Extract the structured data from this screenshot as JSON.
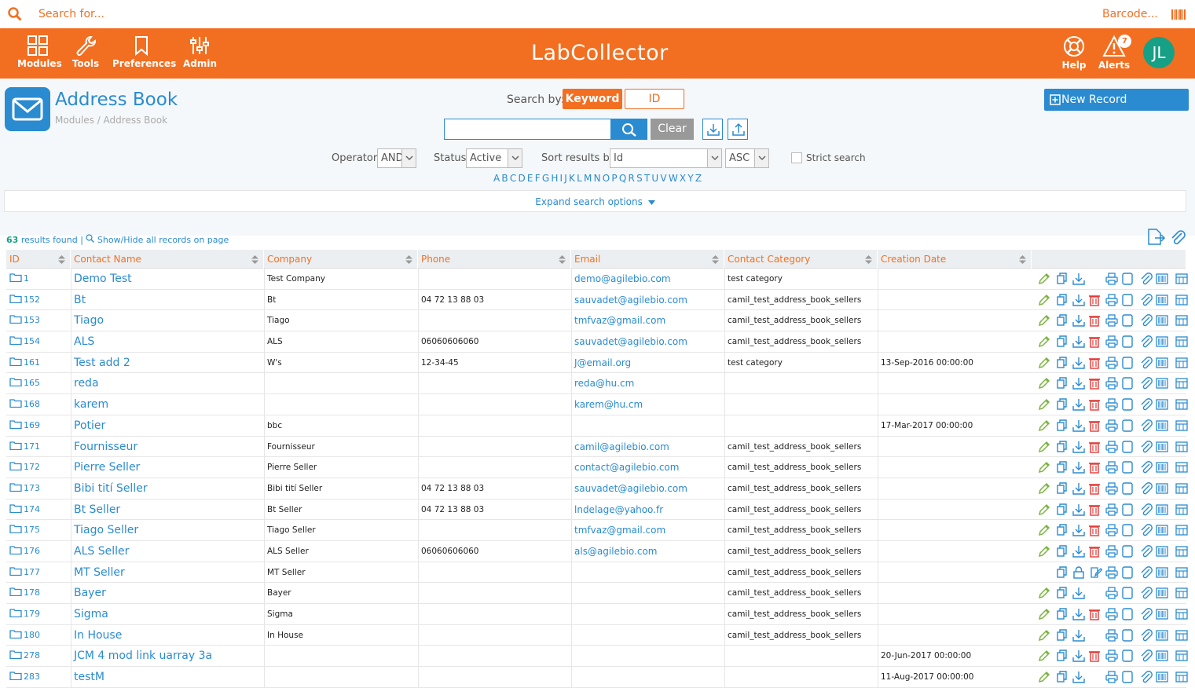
{
  "topbar": {
    "search_placeholder": "Search for...",
    "barcode_label": "Barcode..."
  },
  "nav": {
    "modules": "Modules",
    "tools": "Tools",
    "preferences": "Preferences",
    "admin": "Admin",
    "help": "Help",
    "alerts": "Alerts",
    "alerts_count": "7",
    "avatar": "JL",
    "logo": "LabCollector"
  },
  "page": {
    "title": "Address Book",
    "breadcrumb": "Modules / Address Book",
    "new_record": "New Record"
  },
  "search": {
    "by_label": "Search by:",
    "keyword": "Keyword",
    "id": "ID",
    "clear": "Clear",
    "input_value": ""
  },
  "filters": {
    "operator_label": "Operator:",
    "operator": "AND",
    "status_label": "Status:",
    "status": "Active",
    "sort_label": "Sort results by:",
    "sort": "Id",
    "order": "ASC",
    "strict": "Strict search"
  },
  "alphabet": [
    "A",
    "B",
    "C",
    "D",
    "E",
    "F",
    "G",
    "H",
    "I",
    "J",
    "K",
    "L",
    "M",
    "N",
    "O",
    "P",
    "Q",
    "R",
    "S",
    "T",
    "U",
    "V",
    "W",
    "X",
    "Y",
    "Z"
  ],
  "expand": "Expand search options",
  "results": {
    "count": "63",
    "label": "results found",
    "sep": "|",
    "show_hide": "Show/Hide all records on page"
  },
  "colors": {
    "brand": "#f26f21",
    "accent": "#2a8bd0",
    "green": "#7cb342",
    "red": "#e53935"
  },
  "columns": [
    "ID",
    "Contact Name",
    "Company",
    "Phone",
    "Email",
    "Contact Category",
    "Creation Date"
  ],
  "rows": [
    {
      "id": "1",
      "name": "Demo Test",
      "company": "Test Company",
      "phone": "",
      "email": "demo@agilebio.com",
      "category": "test category",
      "date": "",
      "del": false,
      "lock": false
    },
    {
      "id": "152",
      "name": "Bt",
      "company": "Bt",
      "phone": "04 72 13 88 03",
      "email": "sauvadet@agilebio.com",
      "category": "camil_test_address_book_sellers",
      "date": "",
      "del": true,
      "lock": false
    },
    {
      "id": "153",
      "name": "Tiago",
      "company": "Tiago",
      "phone": "",
      "email": "tmfvaz@gmail.com",
      "category": "camil_test_address_book_sellers",
      "date": "",
      "del": true,
      "lock": false
    },
    {
      "id": "154",
      "name": "ALS",
      "company": "ALS",
      "phone": "06060606060",
      "email": "sauvadet@agilebio.com",
      "category": "camil_test_address_book_sellers",
      "date": "",
      "del": true,
      "lock": false
    },
    {
      "id": "161",
      "name": "Test add 2",
      "company": "W's",
      "phone": "12-34-45",
      "email": "J@email.org",
      "category": "test category",
      "date": "13-Sep-2016 00:00:00",
      "del": true,
      "lock": false
    },
    {
      "id": "165",
      "name": "reda",
      "company": "",
      "phone": "",
      "email": "reda@hu.cm",
      "category": "",
      "date": "",
      "del": true,
      "lock": false
    },
    {
      "id": "168",
      "name": "karem",
      "company": "",
      "phone": "",
      "email": "karem@hu.cm",
      "category": "",
      "date": "",
      "del": true,
      "lock": false
    },
    {
      "id": "169",
      "name": "Potier",
      "company": "bbc",
      "phone": "",
      "email": "",
      "category": "",
      "date": "17-Mar-2017 00:00:00",
      "del": true,
      "lock": false
    },
    {
      "id": "171",
      "name": "Fournisseur",
      "company": "Fournisseur",
      "phone": "",
      "email": "camil@agilebio.com",
      "category": "camil_test_address_book_sellers",
      "date": "",
      "del": true,
      "lock": false
    },
    {
      "id": "172",
      "name": "Pierre Seller",
      "company": "Pierre Seller",
      "phone": "",
      "email": "contact@agilebio.com",
      "category": "camil_test_address_book_sellers",
      "date": "",
      "del": true,
      "lock": false
    },
    {
      "id": "173",
      "name": "Bibi tití Seller",
      "company": "Bibi tití Seller",
      "phone": "04 72 13 88 03",
      "email": "sauvadet@agilebio.com",
      "category": "camil_test_address_book_sellers",
      "date": "",
      "del": true,
      "lock": false
    },
    {
      "id": "174",
      "name": "Bt Seller",
      "company": "Bt Seller",
      "phone": "04 72 13 88 03",
      "email": "lndelage@yahoo.fr",
      "category": "camil_test_address_book_sellers",
      "date": "",
      "del": true,
      "lock": false
    },
    {
      "id": "175",
      "name": "Tiago Seller",
      "company": "Tiago Seller",
      "phone": "",
      "email": "tmfvaz@gmail.com",
      "category": "camil_test_address_book_sellers",
      "date": "",
      "del": true,
      "lock": false
    },
    {
      "id": "176",
      "name": "ALS Seller",
      "company": "ALS Seller",
      "phone": "06060606060",
      "email": "als@agilebio.com",
      "category": "camil_test_address_book_sellers",
      "date": "",
      "del": true,
      "lock": false
    },
    {
      "id": "177",
      "name": "MT Seller",
      "company": "MT Seller",
      "phone": "",
      "email": "",
      "category": "camil_test_address_book_sellers",
      "date": "",
      "del": false,
      "lock": true
    },
    {
      "id": "178",
      "name": "Bayer",
      "company": "Bayer",
      "phone": "",
      "email": "",
      "category": "camil_test_address_book_sellers",
      "date": "",
      "del": false,
      "lock": false
    },
    {
      "id": "179",
      "name": "Sigma",
      "company": "Sigma",
      "phone": "",
      "email": "",
      "category": "camil_test_address_book_sellers",
      "date": "",
      "del": true,
      "lock": false
    },
    {
      "id": "180",
      "name": "In House",
      "company": "In House",
      "phone": "",
      "email": "",
      "category": "camil_test_address_book_sellers",
      "date": "",
      "del": false,
      "lock": false
    },
    {
      "id": "278",
      "name": "JCM 4 mod link uarray 3a",
      "company": "",
      "phone": "",
      "email": "",
      "category": "",
      "date": "20-Jun-2017 00:00:00",
      "del": true,
      "lock": false
    },
    {
      "id": "283",
      "name": "testM",
      "company": "",
      "phone": "",
      "email": "",
      "category": "",
      "date": "11-Aug-2017 00:00:00",
      "del": false,
      "lock": false
    }
  ]
}
